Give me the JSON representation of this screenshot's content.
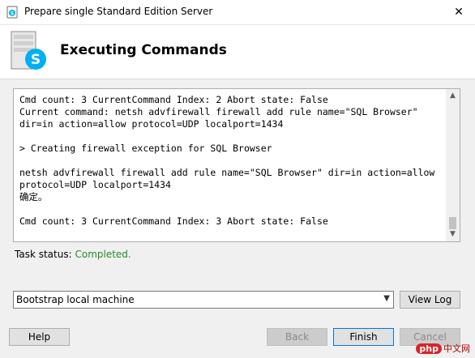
{
  "window": {
    "title": "Prepare single Standard Edition Server",
    "close_glyph": "✕"
  },
  "header": {
    "heading": "Executing Commands"
  },
  "log": {
    "text": "Cmd count: 3 CurrentCommand Index: 2 Abort state: False\nCurrent command: netsh advfirewall firewall add rule name=\"SQL Browser\" dir=in action=allow protocol=UDP localport=1434\n\n> Creating firewall exception for SQL Browser\n\nnetsh advfirewall firewall add rule name=\"SQL Browser\" dir=in action=allow\nprotocol=UDP localport=1434\n确定。\n\nCmd count: 3 CurrentCommand Index: 3 Abort state: False"
  },
  "status": {
    "label": "Task status:",
    "value": "Completed."
  },
  "dropdown": {
    "selected": "Bootstrap local machine"
  },
  "buttons": {
    "view_log": "View Log",
    "help": "Help",
    "back": "Back",
    "finish": "Finish",
    "cancel": "Cancel"
  },
  "icons": {
    "title_icon": "skype-server-icon",
    "header_logo": "skype-for-business-server-icon"
  },
  "watermark": {
    "badge": "php",
    "text": "中文网"
  },
  "colors": {
    "status_completed": "#2a8a2a",
    "skype_blue": "#00aff0",
    "primary_border": "#0078d7"
  }
}
